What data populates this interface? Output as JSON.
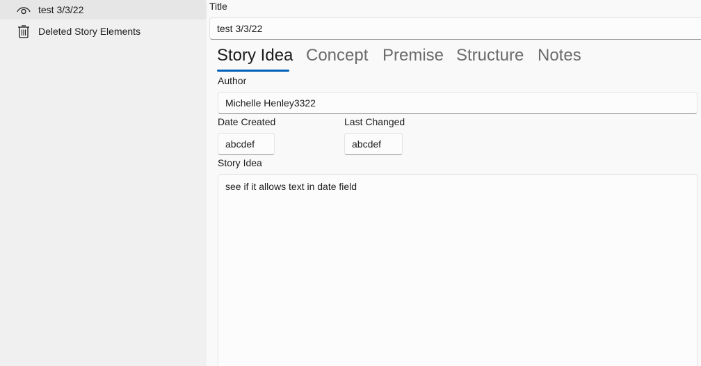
{
  "sidebar": {
    "items": [
      {
        "label": "test 3/3/22",
        "icon": "eye-icon",
        "selected": true
      },
      {
        "label": "Deleted Story Elements",
        "icon": "trash-icon",
        "selected": false
      }
    ]
  },
  "form": {
    "title_label": "Title",
    "title_value": "test 3/3/22",
    "tabs": [
      {
        "label": "Story Idea",
        "active": true
      },
      {
        "label": "Concept",
        "active": false
      },
      {
        "label": "Premise",
        "active": false
      },
      {
        "label": "Structure",
        "active": false
      },
      {
        "label": "Notes",
        "active": false
      }
    ],
    "author_label": "Author",
    "author_value": "Michelle Henley3322",
    "date_created_label": "Date Created",
    "date_created_value": "abcdef",
    "last_changed_label": "Last Changed",
    "last_changed_value": "abcdef",
    "story_idea_label": "Story Idea",
    "story_idea_value": "see if it allows text in date field"
  },
  "colors": {
    "accent": "#005fb8",
    "sidebar_bg": "#f0f0f0",
    "selected_bg": "#e6e6e6"
  }
}
